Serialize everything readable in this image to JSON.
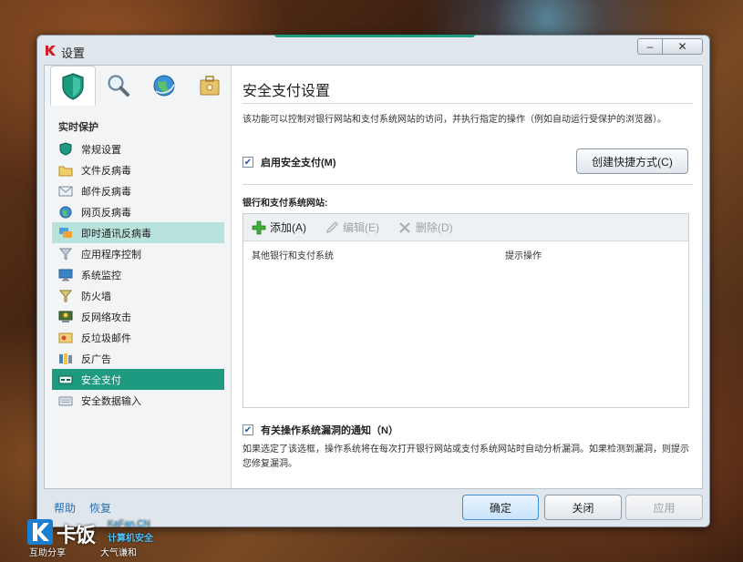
{
  "window": {
    "title": "设置"
  },
  "sidebar": {
    "tabs": [
      {
        "icon": "shield-icon",
        "active": true
      },
      {
        "icon": "magnifier-icon",
        "active": false
      },
      {
        "icon": "globe-icon",
        "active": false
      },
      {
        "icon": "toolbox-icon",
        "active": false
      }
    ],
    "section_title": "实时保护",
    "items": [
      {
        "label": "常规设置",
        "icon": "shield-icon"
      },
      {
        "label": "文件反病毒",
        "icon": "folder-icon"
      },
      {
        "label": "邮件反病毒",
        "icon": "mail-icon"
      },
      {
        "label": "网页反病毒",
        "icon": "globe-icon"
      },
      {
        "label": "即时通讯反病毒",
        "icon": "chat-icon",
        "state": "hover"
      },
      {
        "label": "应用程序控制",
        "icon": "filter-icon"
      },
      {
        "label": "系统监控",
        "icon": "monitor-icon"
      },
      {
        "label": "防火墙",
        "icon": "firewall-icon"
      },
      {
        "label": "反网络攻击",
        "icon": "network-attack-icon"
      },
      {
        "label": "反垃圾邮件",
        "icon": "spam-icon"
      },
      {
        "label": "反广告",
        "icon": "ad-block-icon"
      },
      {
        "label": "安全支付",
        "icon": "safe-money-icon",
        "state": "selected"
      },
      {
        "label": "安全数据输入",
        "icon": "keyboard-icon"
      }
    ]
  },
  "main": {
    "title": "安全支付设置",
    "description": "该功能可以控制对银行网站和支付系统网站的访问，并执行指定的操作（例如自动运行受保护的浏览器）。",
    "enable_checkbox": {
      "label": "启用安全支付(M)",
      "checked": true
    },
    "create_shortcut_label": "创建快捷方式(C)",
    "sites_label": "银行和支付系统网站:",
    "toolbar": {
      "add": "添加(A)",
      "edit": "编辑(E)",
      "delete": "删除(D)"
    },
    "columns": {
      "site": "其他银行和支付系统",
      "action": "提示操作"
    },
    "vuln_checkbox": {
      "label": "有关操作系统漏洞的通知（N）",
      "checked": true
    },
    "vuln_description": "如果选定了该选框，操作系统将在每次打开银行网站或支付系统网站时自动分析漏洞。如果检测到漏洞，则提示您修复漏洞。"
  },
  "footer": {
    "help": "帮助",
    "restore": "恢复",
    "ok": "确定",
    "close": "关闭",
    "apply": "应用"
  },
  "watermark": {
    "brand_cn": "卡饭",
    "brand_en": "KaFan.CN",
    "subtitle": "计算机安全",
    "slogan_left": "互助分享",
    "slogan_right": "大气谦和"
  },
  "colors": {
    "accent": "#1d9a80",
    "hover": "#b8e2dc",
    "link": "#2a6fb0"
  }
}
